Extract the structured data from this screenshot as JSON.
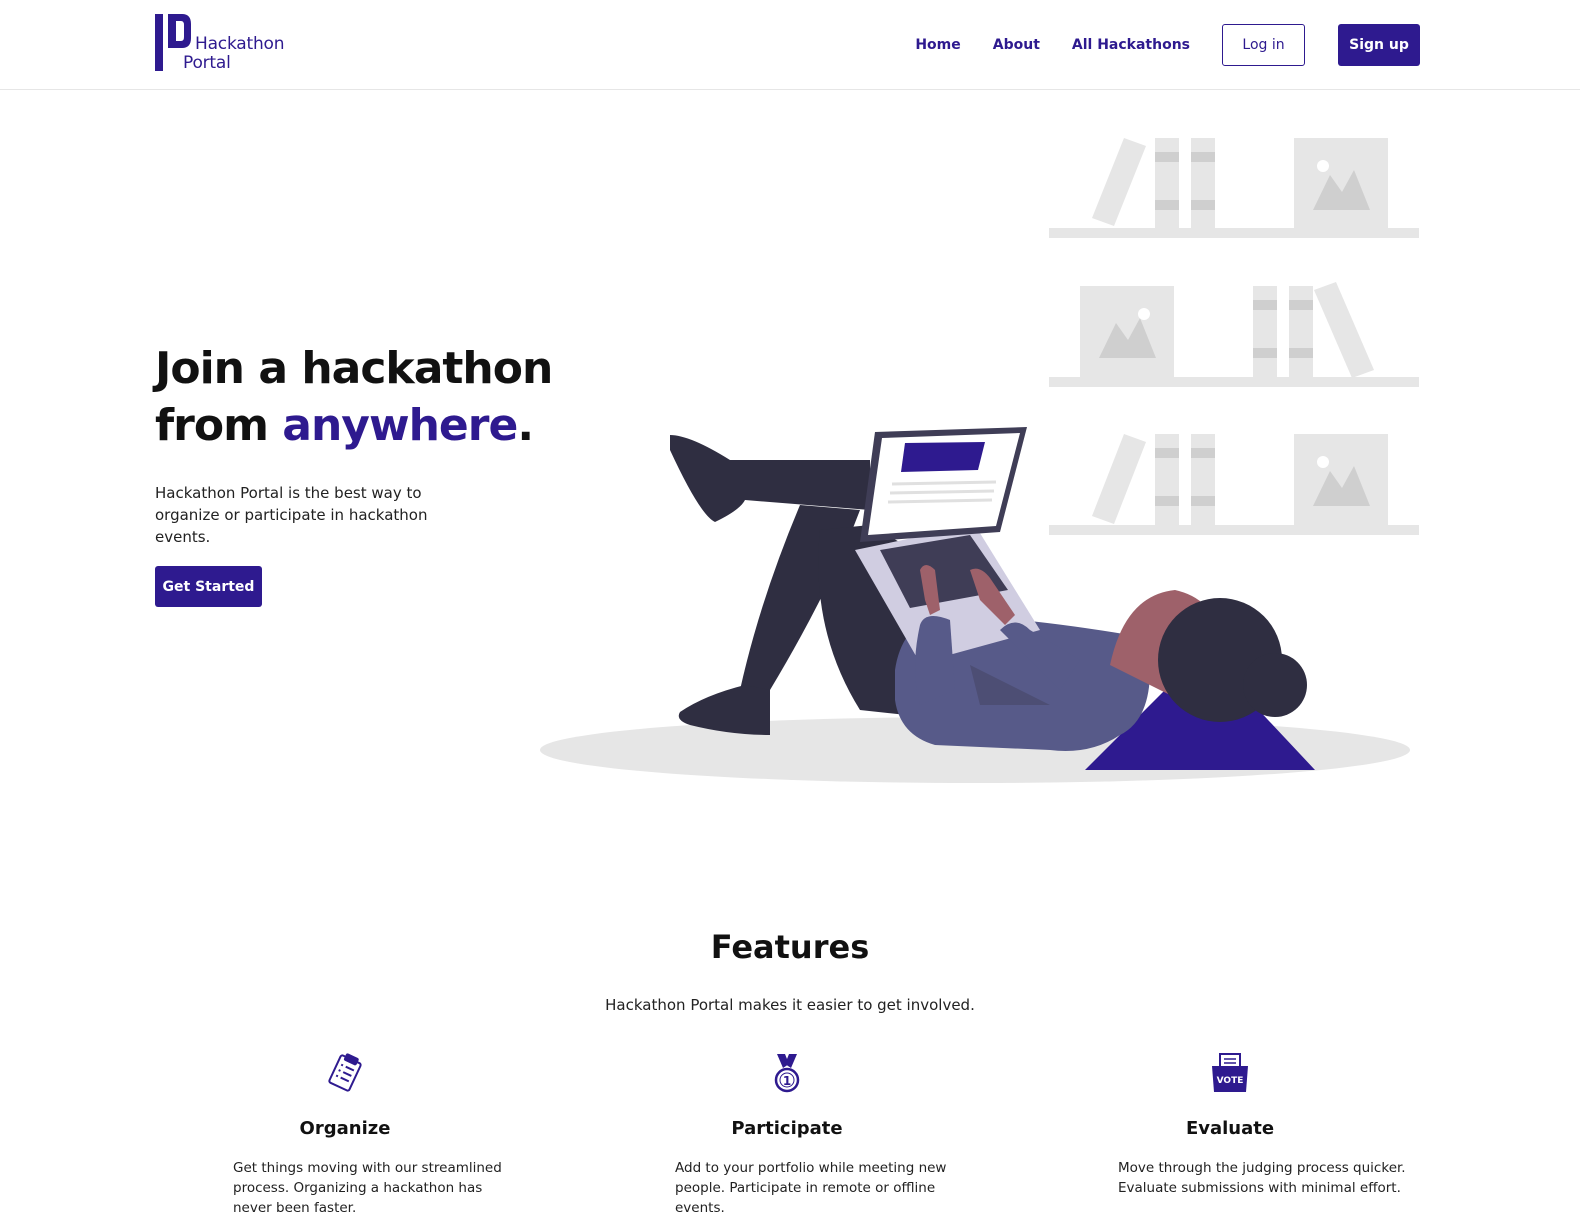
{
  "brand": {
    "line1": "Hackathon",
    "line2": "Portal",
    "color": "#2e1a8f"
  },
  "nav": {
    "home": "Home",
    "about": "About",
    "all_hackathons": "All Hackathons",
    "login": "Log in",
    "signup": "Sign up"
  },
  "hero": {
    "title_line1": "Join a hackathon",
    "title_line2_prefix": "from ",
    "title_accent": "anywhere",
    "title_suffix": ".",
    "description": "Hackathon Portal is the best way to organize or participate in hackathon events.",
    "cta": "Get Started"
  },
  "features": {
    "title": "Features",
    "subtitle": "Hackathon Portal makes it easier to get involved.",
    "items": [
      {
        "icon": "clipboard-icon",
        "name": "Organize",
        "description": "Get things moving with our streamlined process. Organizing a hackathon has never been faster."
      },
      {
        "icon": "medal-icon",
        "name": "Participate",
        "description": "Add to your portfolio while meeting new people. Participate in remote or offline events."
      },
      {
        "icon": "vote-box-icon",
        "name": "Evaluate",
        "description": "Move through the judging process quicker. Evaluate submissions with minimal effort."
      }
    ]
  },
  "vote_label": "VOTE",
  "medal_label": "1"
}
